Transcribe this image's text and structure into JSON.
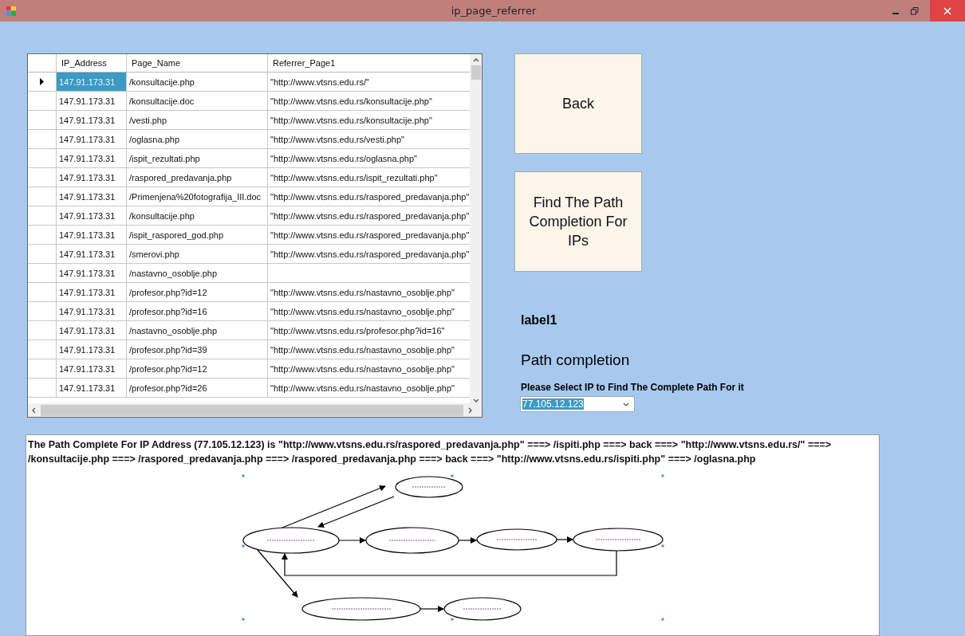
{
  "window": {
    "title": "ip_page_referrer"
  },
  "table": {
    "columns": [
      "IP_Address",
      "Page_Name",
      "Referrer_Page1"
    ],
    "rows": [
      {
        "selected": true,
        "cells": [
          "147.91.173.31",
          "/konsultacije.php",
          "\"http://www.vtsns.edu.rs/\""
        ]
      },
      {
        "selected": false,
        "cells": [
          "147.91.173.31",
          "/konsultacije.doc",
          "\"http://www.vtsns.edu.rs/konsultacije.php\""
        ]
      },
      {
        "selected": false,
        "cells": [
          "147.91.173.31",
          "/vesti.php",
          "\"http://www.vtsns.edu.rs/konsultacije.php\""
        ]
      },
      {
        "selected": false,
        "cells": [
          "147.91.173.31",
          "/oglasna.php",
          "\"http://www.vtsns.edu.rs/vesti.php\""
        ]
      },
      {
        "selected": false,
        "cells": [
          "147.91.173.31",
          "/ispit_rezultati.php",
          "\"http://www.vtsns.edu.rs/oglasna.php\""
        ]
      },
      {
        "selected": false,
        "cells": [
          "147.91.173.31",
          "/raspored_predavanja.php",
          "\"http://www.vtsns.edu.rs/ispit_rezultati.php\""
        ]
      },
      {
        "selected": false,
        "cells": [
          "147.91.173.31",
          "/Primenjena%20fotografija_III.doc",
          "\"http://www.vtsns.edu.rs/raspored_predavanja.php\""
        ]
      },
      {
        "selected": false,
        "cells": [
          "147.91.173.31",
          "/konsultacije.php",
          "\"http://www.vtsns.edu.rs/raspored_predavanja.php\""
        ]
      },
      {
        "selected": false,
        "cells": [
          "147.91.173.31",
          "/ispit_raspored_god.php",
          "\"http://www.vtsns.edu.rs/raspored_predavanja.php\""
        ]
      },
      {
        "selected": false,
        "cells": [
          "147.91.173.31",
          "/smerovi.php",
          "\"http://www.vtsns.edu.rs/raspored_predavanja.php\""
        ]
      },
      {
        "selected": false,
        "cells": [
          "147.91.173.31",
          "/nastavno_osoblje.php"
        ]
      },
      {
        "selected": false,
        "cells": [
          "147.91.173.31",
          "/profesor.php?id=12",
          "\"http://www.vtsns.edu.rs/nastavno_osoblje.php\""
        ]
      },
      {
        "selected": false,
        "cells": [
          "147.91.173.31",
          "/profesor.php?id=16",
          "\"http://www.vtsns.edu.rs/nastavno_osoblje.php\""
        ]
      },
      {
        "selected": false,
        "cells": [
          "147.91.173.31",
          "/nastavno_osoblje.php",
          "\"http://www.vtsns.edu.rs/profesor.php?id=16\""
        ]
      },
      {
        "selected": false,
        "cells": [
          "147.91.173.31",
          "/profesor.php?id=39",
          "\"http://www.vtsns.edu.rs/nastavno_osoblje.php\""
        ]
      },
      {
        "selected": false,
        "cells": [
          "147.91.173.31",
          "/profesor.php?id=12",
          "\"http://www.vtsns.edu.rs/nastavno_osoblje.php\""
        ]
      },
      {
        "selected": false,
        "cells": [
          "147.91.173.31",
          "/profesor.php?id=26",
          "\"http://www.vtsns.edu.rs/nastavno_osoblje.php\""
        ]
      }
    ]
  },
  "buttons": [
    "Back",
    "Find The Path Completion For IPs"
  ],
  "label1": "label1",
  "heading": "Path completion",
  "prompt": "Please Select IP to Find The Complete Path For it",
  "ip_select": {
    "value": "77.105.12.123"
  },
  "result": "The Path Complete For IP Address (77.105.12.123) is \"http://www.vtsns.edu.rs/raspored_predavanja.php\" ===> /ispiti.php ===> back ===> \"http://www.vtsns.edu.rs/\" ===> /konsultacije.php ===> /raspored_predavanja.php ===> /raspored_predavanja.php ===> back ===> \"http://www.vtsns.edu.rs/ispiti.php\" ===> /oglasna.php"
}
